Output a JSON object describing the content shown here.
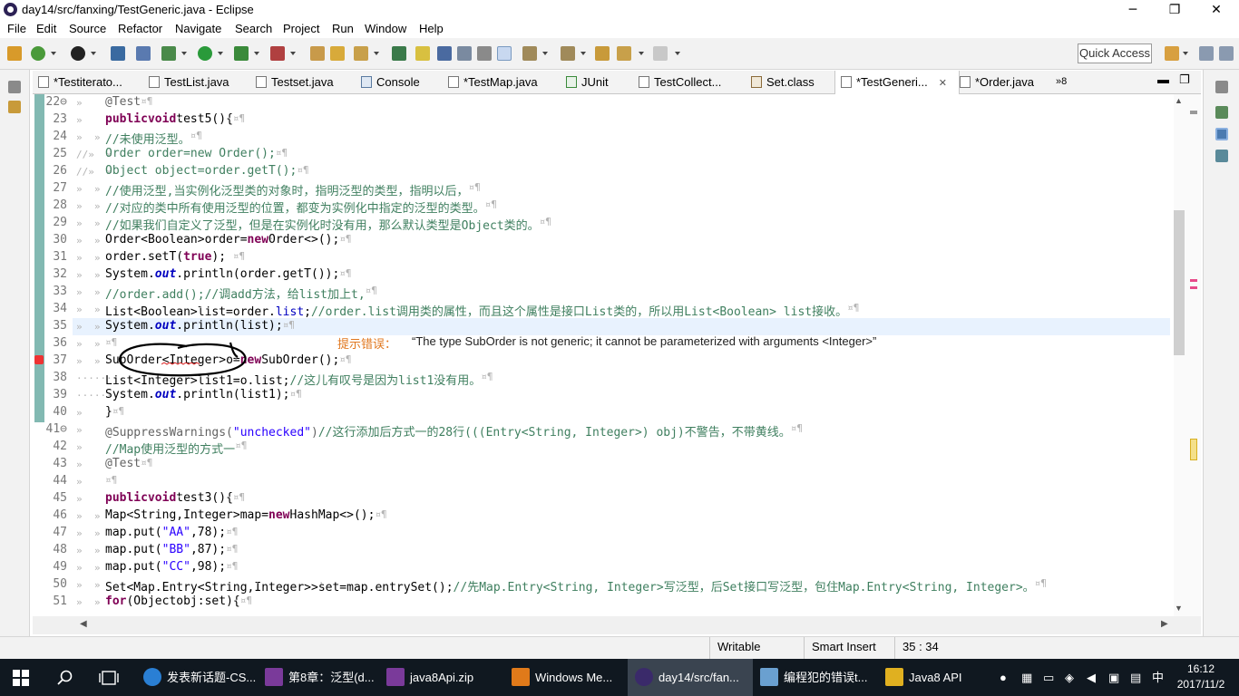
{
  "window": {
    "title": "day14/src/fanxing/TestGeneric.java - Eclipse",
    "minimize": "─",
    "restore": "❐",
    "close": "✕"
  },
  "menu": [
    "File",
    "Edit",
    "Source",
    "Refactor",
    "Navigate",
    "Search",
    "Project",
    "Run",
    "Window",
    "Help"
  ],
  "quick_access": "Quick Access",
  "tabs": [
    {
      "label": "*Testiterato...",
      "icon": "java-file-icon"
    },
    {
      "label": "TestList.java",
      "icon": "java-file-icon"
    },
    {
      "label": "Testset.java",
      "icon": "java-file-icon"
    },
    {
      "label": "Console",
      "icon": "console-icon"
    },
    {
      "label": "*TestMap.java",
      "icon": "java-file-icon"
    },
    {
      "label": "JUnit",
      "icon": "junit-icon"
    },
    {
      "label": "TestCollect...",
      "icon": "java-file-icon"
    },
    {
      "label": "Set.class",
      "icon": "class-file-icon"
    },
    {
      "label": "*TestGeneri...",
      "icon": "java-file-icon",
      "active": true,
      "close": "✕"
    },
    {
      "label": "*Order.java",
      "icon": "java-file-icon"
    }
  ],
  "tab_overflow": "»8",
  "code_lines": [
    {
      "n": "22⊖",
      "ws": "»",
      "segs": [
        [
          "an",
          "@Test"
        ],
        [
          "ws",
          "¤¶"
        ]
      ]
    },
    {
      "n": "23",
      "ws": "»",
      "segs": [
        [
          "kw",
          "public"
        ],
        [
          "ws",
          "·"
        ],
        [
          "kw",
          "void"
        ],
        [
          "ws",
          "·"
        ],
        [
          "",
          "test5()"
        ],
        [
          "ws",
          "·"
        ],
        [
          "",
          "{"
        ],
        [
          "ws",
          "¤¶"
        ]
      ]
    },
    {
      "n": "24",
      "ws": "»  »",
      "segs": [
        [
          "cm",
          "//未使用泛型。"
        ],
        [
          "ws",
          "¤¶"
        ]
      ]
    },
    {
      "n": "25",
      "ws": "//»  »",
      "segs": [
        [
          "cm",
          "Order order=new Order();"
        ],
        [
          "ws",
          "¤¶"
        ]
      ]
    },
    {
      "n": "26",
      "ws": "//»  »",
      "segs": [
        [
          "cm",
          "Object object=order.getT();"
        ],
        [
          "ws",
          "¤¶"
        ]
      ]
    },
    {
      "n": "27",
      "ws": "»  »",
      "segs": [
        [
          "cm",
          "//使用泛型,当实例化泛型类的对象时，指明泛型的类型，指明以后，"
        ],
        [
          "ws",
          "¤¶"
        ]
      ]
    },
    {
      "n": "28",
      "ws": "»  »",
      "segs": [
        [
          "cm",
          "//对应的类中所有使用泛型的位置，都变为实例化中指定的泛型的类型。"
        ],
        [
          "ws",
          "¤¶"
        ]
      ]
    },
    {
      "n": "29",
      "ws": "»  »",
      "segs": [
        [
          "cm",
          "//如果我们自定义了泛型，但是在实例化时没有用，那么默认类型是Object类的。"
        ],
        [
          "ws",
          "¤¶"
        ]
      ]
    },
    {
      "n": "30",
      "ws": "»  »",
      "segs": [
        [
          "",
          "Order<Boolean>"
        ],
        [
          "ws",
          "·"
        ],
        [
          "",
          "order="
        ],
        [
          "kw",
          "new"
        ],
        [
          "ws",
          "·"
        ],
        [
          "",
          "Order<>();"
        ],
        [
          "ws",
          "¤¶"
        ]
      ]
    },
    {
      "n": "31",
      "ws": "»  »",
      "segs": [
        [
          "",
          "order.setT("
        ],
        [
          "kw",
          "true"
        ],
        [
          "",
          "); "
        ],
        [
          "ws",
          "¤¶"
        ]
      ]
    },
    {
      "n": "32",
      "ws": "»  »",
      "segs": [
        [
          "",
          "System."
        ],
        [
          "it",
          "out"
        ],
        [
          "",
          "."
        ],
        [
          "",
          "println(order.getT());"
        ],
        [
          "ws",
          "¤¶"
        ]
      ]
    },
    {
      "n": "33",
      "ws": "»  »",
      "segs": [
        [
          "cm",
          "//order.add();//调add方法，给list加上t,"
        ],
        [
          "ws",
          "¤¶"
        ]
      ]
    },
    {
      "n": "34",
      "ws": "»  »",
      "segs": [
        [
          "",
          "List<Boolean>"
        ],
        [
          "ws",
          "·"
        ],
        [
          "",
          "list=order."
        ],
        [
          "fd",
          "list"
        ],
        [
          "",
          ";"
        ],
        [
          "cm",
          "//order.list调用类的属性，而且这个属性是接口List类的，所以用List<Boolean> list接收。"
        ],
        [
          "ws",
          "¤¶"
        ]
      ]
    },
    {
      "n": "35",
      "ws": "»  »",
      "segs": [
        [
          "",
          "System."
        ],
        [
          "it",
          "out"
        ],
        [
          "",
          ".println(list);"
        ],
        [
          "ws",
          "¤¶"
        ]
      ]
    },
    {
      "n": "36",
      "ws": "»  »",
      "segs": [
        [
          "ws",
          "¤¶"
        ]
      ]
    },
    {
      "n": "37",
      "ws": "»  »",
      "segs": [
        [
          "",
          "SubOrder<Integer>"
        ],
        [
          "ws",
          "·"
        ],
        [
          "",
          "o"
        ],
        [
          "ws",
          "·"
        ],
        [
          "",
          "="
        ],
        [
          "kw",
          "new"
        ],
        [
          "ws",
          "·"
        ],
        [
          "",
          "SubOrder();"
        ],
        [
          "ws",
          "¤¶"
        ]
      ]
    },
    {
      "n": "38",
      "ws": "·······",
      "segs": [
        [
          "",
          "List<Integer>"
        ],
        [
          "ws",
          "·"
        ],
        [
          "",
          "list1=o.list;"
        ],
        [
          "cm",
          "//这儿有叹号是因为list1没有用。"
        ],
        [
          "ws",
          "¤¶"
        ]
      ]
    },
    {
      "n": "39",
      "ws": "·······",
      "segs": [
        [
          "",
          "System."
        ],
        [
          "it",
          "out"
        ],
        [
          "",
          ".println(list1);"
        ],
        [
          "ws",
          "¤¶"
        ]
      ]
    },
    {
      "n": "40",
      "ws": "»",
      "segs": [
        [
          "",
          "}"
        ],
        [
          "ws",
          "¤¶"
        ]
      ]
    },
    {
      "n": "41⊖",
      "ws": "»",
      "segs": [
        [
          "an",
          "@SuppressWarnings("
        ],
        [
          "st",
          "\"unchecked\""
        ],
        [
          "an",
          ")"
        ],
        [
          "cm",
          "//这行添加后方式一的28行(((Entry<String, Integer>) obj)不警告，不带黄线。"
        ],
        [
          "ws",
          "¤¶"
        ]
      ]
    },
    {
      "n": "42",
      "ws": "»",
      "segs": [
        [
          "cm",
          "//Map使用泛型的方式一"
        ],
        [
          "ws",
          "¤¶"
        ]
      ]
    },
    {
      "n": "43",
      "ws": "»",
      "segs": [
        [
          "an",
          "@Test"
        ],
        [
          "ws",
          "¤¶"
        ]
      ]
    },
    {
      "n": "44",
      "ws": "»",
      "segs": [
        [
          "ws",
          "¤¶"
        ]
      ]
    },
    {
      "n": "45",
      "ws": "»",
      "segs": [
        [
          "kw",
          "public"
        ],
        [
          "ws",
          "·"
        ],
        [
          "kw",
          "void"
        ],
        [
          "ws",
          "·"
        ],
        [
          "",
          "test3()"
        ],
        [
          "ws",
          "·"
        ],
        [
          "",
          "{"
        ],
        [
          "ws",
          "¤¶"
        ]
      ]
    },
    {
      "n": "46",
      "ws": "»  »",
      "segs": [
        [
          "",
          "Map"
        ],
        [
          "ws",
          "·"
        ],
        [
          "",
          "<String,Integer>map="
        ],
        [
          "kw",
          "new"
        ],
        [
          "ws",
          "·"
        ],
        [
          "",
          "HashMap<>();"
        ],
        [
          "ws",
          "¤¶"
        ]
      ]
    },
    {
      "n": "47",
      "ws": "»  »",
      "segs": [
        [
          "",
          "map.put("
        ],
        [
          "st",
          "\"AA\""
        ],
        [
          "",
          ","
        ],
        [
          "ws",
          "·"
        ],
        [
          "",
          "78);"
        ],
        [
          "ws",
          "¤¶"
        ]
      ]
    },
    {
      "n": "48",
      "ws": "»  »",
      "segs": [
        [
          "",
          "map.put("
        ],
        [
          "st",
          "\"BB\""
        ],
        [
          "",
          ","
        ],
        [
          "ws",
          "·"
        ],
        [
          "",
          "87);"
        ],
        [
          "ws",
          "¤¶"
        ]
      ]
    },
    {
      "n": "49",
      "ws": "»  »",
      "segs": [
        [
          "",
          "map.put("
        ],
        [
          "st",
          "\"CC\""
        ],
        [
          "",
          ","
        ],
        [
          "ws",
          "·"
        ],
        [
          "",
          "98);"
        ],
        [
          "ws",
          "¤¶"
        ]
      ]
    },
    {
      "n": "50",
      "ws": "»  »",
      "segs": [
        [
          "",
          "Set<Map.Entry<String,"
        ],
        [
          "ws",
          "·"
        ],
        [
          "",
          "Integer>>"
        ],
        [
          "ws",
          "·"
        ],
        [
          "",
          "set=map.entrySet();"
        ],
        [
          "cm",
          "//先Map.Entry<String, Integer>写泛型，后Set接口写泛型，包住Map.Entry<String, Integer>。"
        ],
        [
          "ws",
          "¤¶"
        ]
      ]
    },
    {
      "n": "51",
      "ws": "»  »",
      "segs": [
        [
          "kw",
          "for"
        ],
        [
          "",
          "(Object"
        ],
        [
          "ws",
          "·"
        ],
        [
          "",
          "obj:set)"
        ],
        [
          "ws",
          "·"
        ],
        [
          "",
          "{"
        ],
        [
          "ws",
          "¤¶"
        ]
      ]
    }
  ],
  "hint": {
    "label": "提示错误：",
    "message": "“The type SubOrder is not generic; it cannot be parameterized with arguments <Integer>”"
  },
  "status": {
    "writable": "Writable",
    "insert_mode": "Smart Insert",
    "position": "35 : 34"
  },
  "taskbar": {
    "apps": [
      {
        "label": "发表新话题-CS...",
        "color": "#2a7fd4"
      },
      {
        "label": "第8章：泛型(d...",
        "color": "#7a3a9a"
      },
      {
        "label": "java8Api.zip",
        "color": "#7a3a9a"
      },
      {
        "label": "Windows Me...",
        "color": "#e07a1a"
      },
      {
        "label": "day14/src/fan...",
        "color": "#3a2a6a",
        "active": true
      },
      {
        "label": "编程犯的错误t...",
        "color": "#6aa0d0"
      },
      {
        "label": "Java8 API",
        "color": "#e0b020"
      }
    ],
    "ime": "中",
    "time": "16:12",
    "date": "2017/11/2"
  }
}
